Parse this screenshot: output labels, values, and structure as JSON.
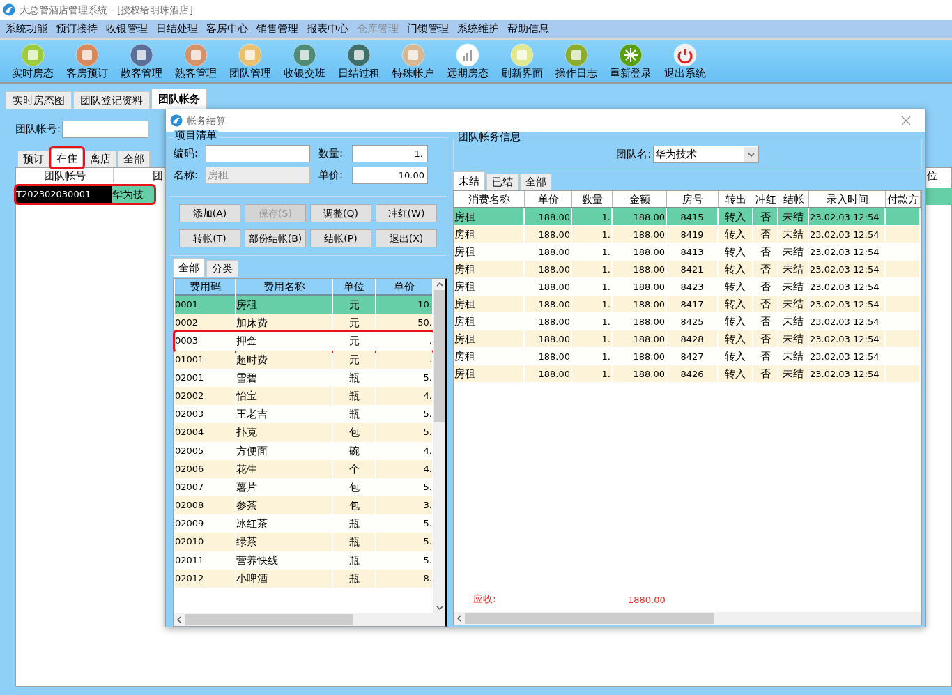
{
  "window": {
    "title": "大总管酒店管理系统 - [授权给明珠酒店]"
  },
  "menu": [
    {
      "label": "系统功能",
      "disabled": false
    },
    {
      "label": "预订接待",
      "disabled": false
    },
    {
      "label": "收银管理",
      "disabled": false
    },
    {
      "label": "日结处理",
      "disabled": false
    },
    {
      "label": "客房中心",
      "disabled": false
    },
    {
      "label": "销售管理",
      "disabled": false
    },
    {
      "label": "报表中心",
      "disabled": false
    },
    {
      "label": "仓库管理",
      "disabled": true
    },
    {
      "label": "门锁管理",
      "disabled": false
    },
    {
      "label": "系统维护",
      "disabled": false
    },
    {
      "label": "帮助信息",
      "disabled": false
    }
  ],
  "toolbar": [
    "实时房态",
    "客房预订",
    "散客管理",
    "熟客管理",
    "团队管理",
    "收银交班",
    "日结过租",
    "特殊帐户",
    "远期房态",
    "刷新界面",
    "操作日志",
    "重新登录",
    "退出系统"
  ],
  "tabs": [
    {
      "label": "实时房态图",
      "selected": false
    },
    {
      "label": "团队登记资料",
      "selected": false
    },
    {
      "label": "团队帐务",
      "selected": true
    }
  ],
  "account_search": {
    "label": "团队帐号:"
  },
  "status_tabs": [
    {
      "label": "预订",
      "selected": false,
      "highlighted": false
    },
    {
      "label": "在住",
      "selected": true,
      "highlighted": true
    },
    {
      "label": "离店",
      "selected": false,
      "highlighted": false
    },
    {
      "label": "全部",
      "selected": false,
      "highlighted": false
    }
  ],
  "accounts_table": {
    "columns": [
      "团队帐号",
      "团",
      "位"
    ],
    "rows": [
      {
        "cells": [
          "T202302030001",
          "华为技"
        ],
        "selected": true,
        "highlighted": true
      }
    ]
  },
  "dialog": {
    "title": "帐务结算",
    "item_group": {
      "title": "项目清单",
      "code": {
        "label": "编码:"
      },
      "quantity": {
        "label": "数量:",
        "value": "1."
      },
      "name": {
        "label": "名称:",
        "value": "房租",
        "disabled": true
      },
      "price": {
        "label": "单价:",
        "value": "10.00"
      }
    },
    "buttons": [
      {
        "label": "添加(A)",
        "disabled": false
      },
      {
        "label": "保存(S)",
        "disabled": true
      },
      {
        "label": "调整(Q)",
        "disabled": false
      },
      {
        "label": "冲红(W)",
        "disabled": false
      },
      {
        "label": "转帐(T)",
        "disabled": false
      },
      {
        "label": "部份结帐(B)",
        "disabled": false
      },
      {
        "label": "结帐(P)",
        "disabled": false
      },
      {
        "label": "退出(X)",
        "disabled": false
      }
    ],
    "list_tabs": [
      {
        "label": "全部",
        "selected": true
      },
      {
        "label": "分类",
        "selected": false
      }
    ],
    "fee_table": {
      "columns": [
        "费用码",
        "费用名称",
        "单位",
        "单价"
      ],
      "rows": [
        {
          "cells": [
            "0001",
            "房租",
            "元",
            "10."
          ],
          "selected": true,
          "highlighted": false
        },
        {
          "cells": [
            "0002",
            "加床费",
            "元",
            "50."
          ],
          "selected": false,
          "highlighted": false
        },
        {
          "cells": [
            "0003",
            "押金",
            "元",
            "."
          ],
          "selected": false,
          "highlighted": true
        },
        {
          "cells": [
            "01001",
            "超时费",
            "元",
            "."
          ],
          "selected": false,
          "highlighted": false
        },
        {
          "cells": [
            "02001",
            "雪碧",
            "瓶",
            "5."
          ],
          "selected": false,
          "highlighted": false
        },
        {
          "cells": [
            "02002",
            "怡宝",
            "瓶",
            "4."
          ],
          "selected": false,
          "highlighted": false
        },
        {
          "cells": [
            "02003",
            "王老吉",
            "瓶",
            "5."
          ],
          "selected": false,
          "highlighted": false
        },
        {
          "cells": [
            "02004",
            "扑克",
            "包",
            "5."
          ],
          "selected": false,
          "highlighted": false
        },
        {
          "cells": [
            "02005",
            "方便面",
            "碗",
            "4."
          ],
          "selected": false,
          "highlighted": false
        },
        {
          "cells": [
            "02006",
            "花生",
            "个",
            "4."
          ],
          "selected": false,
          "highlighted": false
        },
        {
          "cells": [
            "02007",
            "薯片",
            "包",
            "5."
          ],
          "selected": false,
          "highlighted": false
        },
        {
          "cells": [
            "02008",
            "参茶",
            "包",
            "3."
          ],
          "selected": false,
          "highlighted": false
        },
        {
          "cells": [
            "02009",
            "冰红茶",
            "瓶",
            "5."
          ],
          "selected": false,
          "highlighted": false
        },
        {
          "cells": [
            "02010",
            "绿茶",
            "瓶",
            "5."
          ],
          "selected": false,
          "highlighted": false
        },
        {
          "cells": [
            "02011",
            "营养快线",
            "瓶",
            "5."
          ],
          "selected": false,
          "highlighted": false
        },
        {
          "cells": [
            "02012",
            "小啤酒",
            "瓶",
            "8."
          ],
          "selected": false,
          "highlighted": false
        }
      ]
    }
  },
  "account_info": {
    "title": "团队帐务信息",
    "team_label": "团队名:",
    "team_value": "华为技术"
  },
  "bill_tabs": [
    {
      "label": "未结",
      "selected": true
    },
    {
      "label": "已结",
      "selected": false
    },
    {
      "label": "全部",
      "selected": false
    }
  ],
  "bill_table": {
    "columns": [
      "消费名称",
      "单价",
      "数量",
      "金额",
      "房号",
      "转出",
      "冲红",
      "结帐",
      "录入时间",
      "付款方"
    ],
    "rows": [
      {
        "cells": [
          "房租",
          "188.00",
          "1.",
          "188.00",
          "8415",
          "转入",
          "否",
          "未结",
          "23.02.03 12:54"
        ],
        "selected": true
      },
      {
        "cells": [
          "房租",
          "188.00",
          "1.",
          "188.00",
          "8419",
          "转入",
          "否",
          "未结",
          "23.02.03 12:54"
        ],
        "selected": false
      },
      {
        "cells": [
          "房租",
          "188.00",
          "1.",
          "188.00",
          "8413",
          "转入",
          "否",
          "未结",
          "23.02.03 12:54"
        ],
        "selected": false
      },
      {
        "cells": [
          "房租",
          "188.00",
          "1.",
          "188.00",
          "8421",
          "转入",
          "否",
          "未结",
          "23.02.03 12:54"
        ],
        "selected": false
      },
      {
        "cells": [
          "房租",
          "188.00",
          "1.",
          "188.00",
          "8423",
          "转入",
          "否",
          "未结",
          "23.02.03 12:54"
        ],
        "selected": false
      },
      {
        "cells": [
          "房租",
          "188.00",
          "1.",
          "188.00",
          "8417",
          "转入",
          "否",
          "未结",
          "23.02.03 12:54"
        ],
        "selected": false
      },
      {
        "cells": [
          "房租",
          "188.00",
          "1.",
          "188.00",
          "8425",
          "转入",
          "否",
          "未结",
          "23.02.03 12:54"
        ],
        "selected": false
      },
      {
        "cells": [
          "房租",
          "188.00",
          "1.",
          "188.00",
          "8428",
          "转入",
          "否",
          "未结",
          "23.02.03 12:54"
        ],
        "selected": false
      },
      {
        "cells": [
          "房租",
          "188.00",
          "1.",
          "188.00",
          "8427",
          "转入",
          "否",
          "未结",
          "23.02.03 12:54"
        ],
        "selected": false
      },
      {
        "cells": [
          "房租",
          "188.00",
          "1.",
          "188.00",
          "8426",
          "转入",
          "否",
          "未结",
          "23.02.03 12:54"
        ],
        "selected": false
      }
    ]
  },
  "receivable": {
    "label": "应收:",
    "value": "1880.00"
  }
}
